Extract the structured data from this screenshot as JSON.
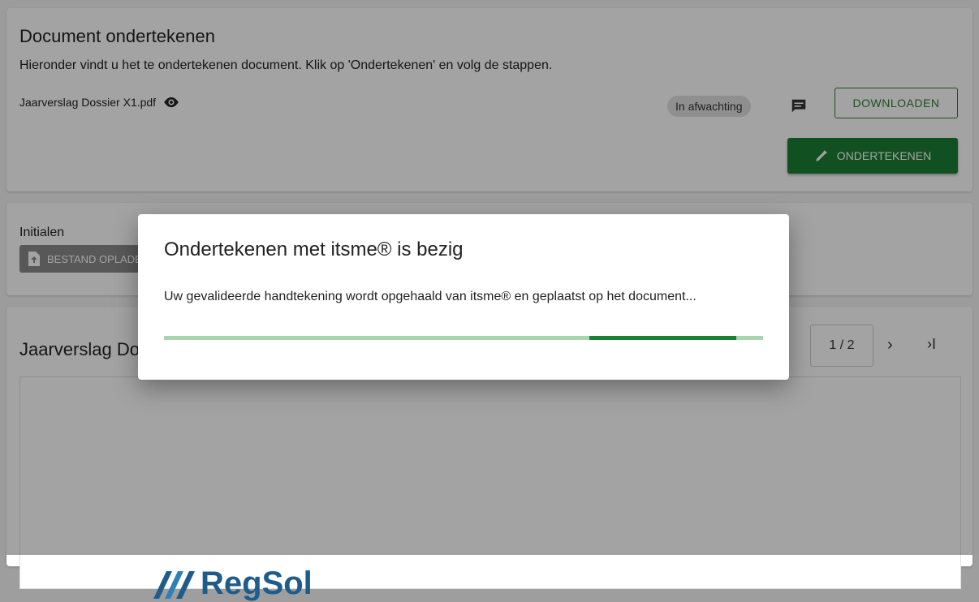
{
  "header": {
    "title": "Document ondertekenen",
    "subtitle": "Hieronder vindt u het te ondertekenen document. Klik op 'Ondertekenen' en volg de stappen.",
    "file_name": "Jaarverslag Dossier X1.pdf",
    "status": "In afwachting",
    "download_label": "DOWNLOADEN",
    "sign_label": "ONDERTEKENEN"
  },
  "initials": {
    "label": "Initialen",
    "upload_label": "BESTAND OPLADEN"
  },
  "viewer": {
    "title": "Jaarverslag Dossier X1.pdf",
    "page_indicator": "1 / 2",
    "next_icon": "›",
    "last_icon": "›I",
    "logo_text": "RegSol"
  },
  "dialog": {
    "title": "Ondertekenen met itsme® is bezig",
    "message": "Uw gevalideerde handtekening wordt opgehaald van itsme® en geplaatst op het document...",
    "progress": {
      "fill_start": 0.71,
      "fill_end": 0.955
    }
  },
  "colors": {
    "primary_green": "#1b7f34",
    "progress_track": "#a8d5b0",
    "logo_blue": "#1f5c8c"
  }
}
